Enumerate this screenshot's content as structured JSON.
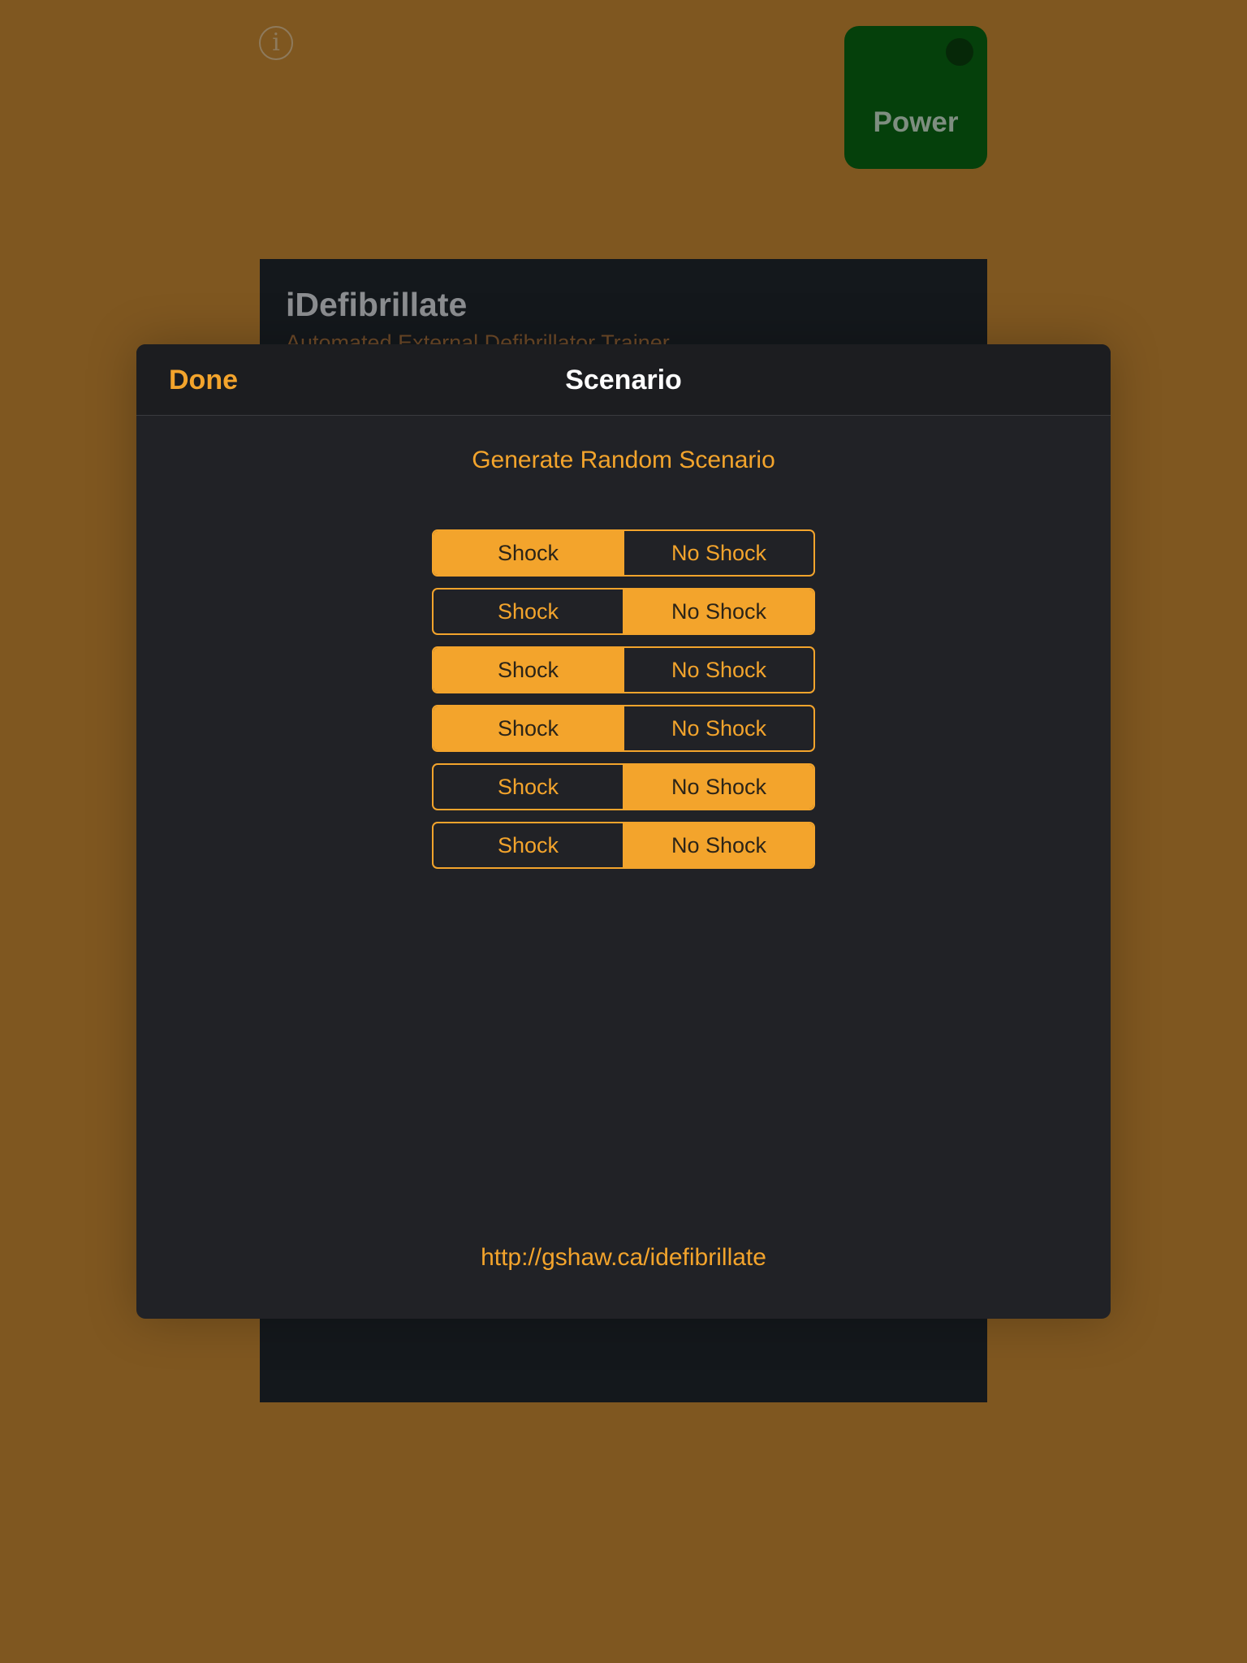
{
  "background": {
    "info_icon": "info-icon",
    "info_glyph": "i",
    "power_label": "Power",
    "app_title": "iDefibrillate",
    "app_subtitle": "Automated External Defibrillator Trainer",
    "colors": {
      "backdrop": "#7f5720",
      "power_button": "#05400b",
      "device_panel": "#14181c"
    }
  },
  "modal": {
    "done_label": "Done",
    "title": "Scenario",
    "generate_label": "Generate Random Scenario",
    "segments": [
      {
        "options": [
          "Shock",
          "No Shock"
        ],
        "selected": "Shock"
      },
      {
        "options": [
          "Shock",
          "No Shock"
        ],
        "selected": "No Shock"
      },
      {
        "options": [
          "Shock",
          "No Shock"
        ],
        "selected": "Shock"
      },
      {
        "options": [
          "Shock",
          "No Shock"
        ],
        "selected": "Shock"
      },
      {
        "options": [
          "Shock",
          "No Shock"
        ],
        "selected": "No Shock"
      },
      {
        "options": [
          "Shock",
          "No Shock"
        ],
        "selected": "No Shock"
      }
    ],
    "footer_link": "http://gshaw.ca/idefibrillate",
    "colors": {
      "accent": "#f3a42c",
      "sheet": "#212226",
      "header": "#1c1d20"
    }
  }
}
